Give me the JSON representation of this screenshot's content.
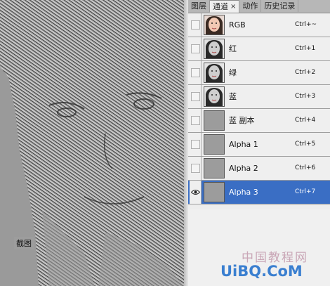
{
  "panel": {
    "tabs": [
      {
        "label": "图层"
      },
      {
        "label": "通道",
        "active": true,
        "close": "×"
      },
      {
        "label": "动作"
      },
      {
        "label": "历史记录"
      }
    ],
    "menu_glyph": "»"
  },
  "channels": [
    {
      "name": "RGB",
      "shortcut": "Ctrl+~",
      "thumb": "face-color",
      "visible": false,
      "selected": false
    },
    {
      "name": "红",
      "shortcut": "Ctrl+1",
      "thumb": "face-gray",
      "visible": false,
      "selected": false
    },
    {
      "name": "绿",
      "shortcut": "Ctrl+2",
      "thumb": "face-gray",
      "visible": false,
      "selected": false
    },
    {
      "name": "蓝",
      "shortcut": "Ctrl+3",
      "thumb": "face-gray",
      "visible": false,
      "selected": false
    },
    {
      "name": "蓝 副本",
      "shortcut": "Ctrl+4",
      "thumb": "gray",
      "visible": false,
      "selected": false
    },
    {
      "name": "Alpha 1",
      "shortcut": "Ctrl+5",
      "thumb": "gray",
      "visible": false,
      "selected": false
    },
    {
      "name": "Alpha 2",
      "shortcut": "Ctrl+6",
      "thumb": "gray",
      "visible": false,
      "selected": false
    },
    {
      "name": "Alpha 3",
      "shortcut": "Ctrl+7",
      "thumb": "gray",
      "visible": true,
      "selected": true
    }
  ],
  "canvas": {
    "label": "截图"
  },
  "watermark": {
    "cn": "中国教程网",
    "en": "UiBQ.CoM"
  },
  "colors": {
    "selected_row": "#3a6ec4",
    "canvas_gray": "#9a9a9a"
  }
}
